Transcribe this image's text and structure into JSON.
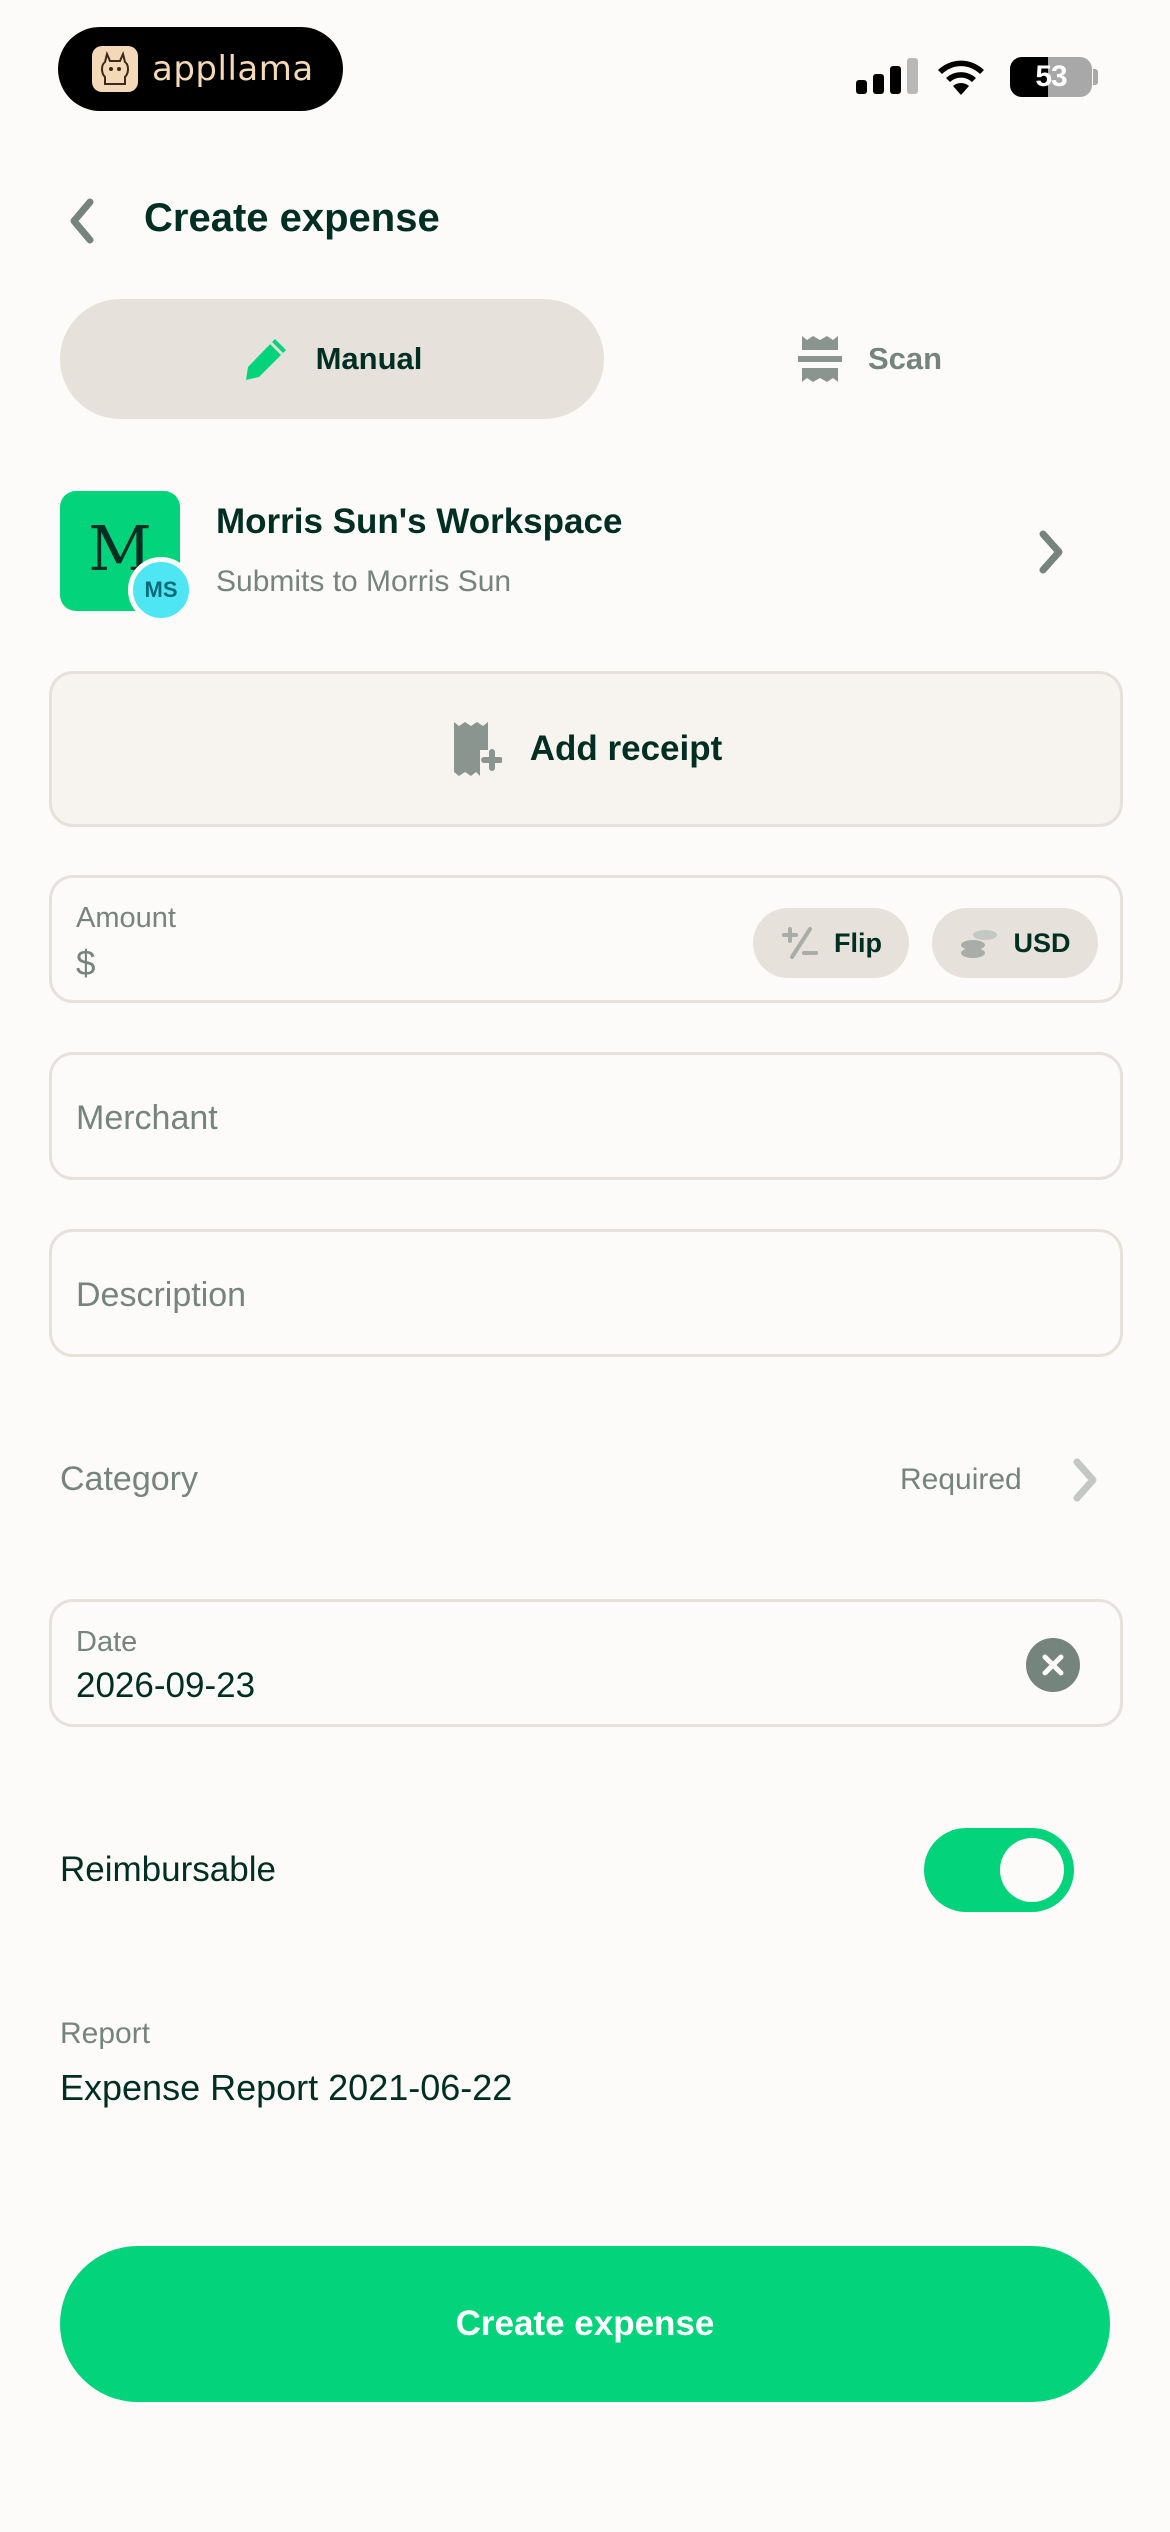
{
  "status_bar": {
    "app_pill_text": "appllama",
    "battery_level": "53"
  },
  "header": {
    "title": "Create expense",
    "back_icon": "chevron-left-icon"
  },
  "tabs": [
    {
      "label": "Manual",
      "icon": "pencil-icon",
      "selected": true
    },
    {
      "label": "Scan",
      "icon": "receipt-scan-icon",
      "selected": false
    }
  ],
  "workspace": {
    "avatar_letter": "M",
    "user_initials": "MS",
    "name": "Morris Sun's Workspace",
    "submits_to": "Submits to Morris Sun"
  },
  "receipt": {
    "label": "Add receipt",
    "icon": "receipt-plus-icon"
  },
  "amount": {
    "label": "Amount",
    "currency_symbol": "$",
    "flip_label": "Flip",
    "currency_label": "USD"
  },
  "merchant": {
    "placeholder": "Merchant"
  },
  "description": {
    "placeholder": "Description"
  },
  "category": {
    "label": "Category",
    "status": "Required"
  },
  "date": {
    "label": "Date",
    "value": "2026-09-23"
  },
  "reimbursable": {
    "label": "Reimbursable",
    "enabled": true
  },
  "report": {
    "label": "Report",
    "value": "Expense Report 2021-06-22"
  },
  "submit": {
    "label": "Create expense"
  },
  "colors": {
    "accent": "#03D47C",
    "background": "#FCFBF9",
    "text": "#002E22",
    "muted": "#76847E",
    "border": "#E6E1DA"
  }
}
